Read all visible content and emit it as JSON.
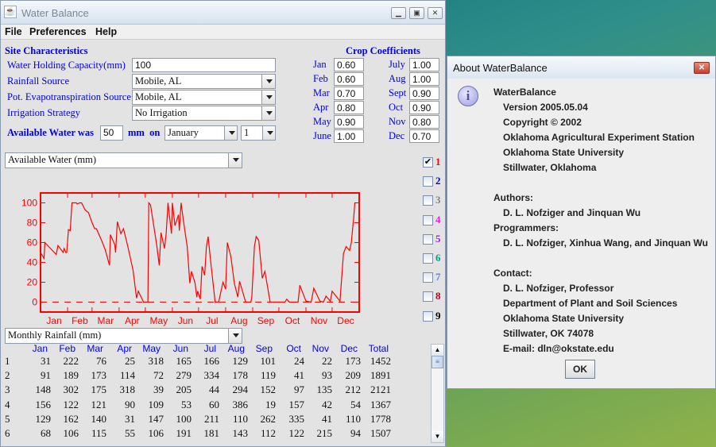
{
  "window": {
    "title": "Water Balance",
    "buttons": [
      "minimize",
      "maximize",
      "close"
    ]
  },
  "menu": [
    "File",
    "Preferences",
    "Help"
  ],
  "site": {
    "heading": "Site Characteristics",
    "whc_label": "Water Holding Capacity(mm)",
    "whc_value": "100",
    "rain_label": "Rainfall Source",
    "rain_value": "Mobile, AL",
    "pet_label": "Pot. Evapotranspiration Source",
    "pet_value": "Mobile, AL",
    "irr_label": "Irrigation Strategy",
    "irr_value": "No Irrigation",
    "aw_label": "Available Water was",
    "aw_value": "50",
    "aw_unit": "mm  on",
    "aw_month": "January",
    "aw_day": "1"
  },
  "crop": {
    "heading": "Crop Coefficients",
    "left": [
      {
        "m": "Jan",
        "v": "0.60"
      },
      {
        "m": "Feb",
        "v": "0.60"
      },
      {
        "m": "Mar",
        "v": "0.70"
      },
      {
        "m": "Apr",
        "v": "0.80"
      },
      {
        "m": "May",
        "v": "0.90"
      },
      {
        "m": "June",
        "v": "1.00"
      }
    ],
    "right": [
      {
        "m": "July",
        "v": "1.00"
      },
      {
        "m": "Aug",
        "v": "1.00"
      },
      {
        "m": "Sept",
        "v": "0.90"
      },
      {
        "m": "Oct",
        "v": "0.90"
      },
      {
        "m": "Nov",
        "v": "0.80"
      },
      {
        "m": "Dec",
        "v": "0.70"
      }
    ]
  },
  "plot_select": "Available Water (mm)",
  "series_checks": [
    {
      "n": "1",
      "checked": true,
      "color": "#ff0000"
    },
    {
      "n": "2",
      "checked": false,
      "color": "#0000ee"
    },
    {
      "n": "3",
      "checked": false,
      "color": "#808080"
    },
    {
      "n": "4",
      "checked": false,
      "color": "#e020e0"
    },
    {
      "n": "5",
      "checked": false,
      "color": "#a020f0"
    },
    {
      "n": "6",
      "checked": false,
      "color": "#00a080"
    },
    {
      "n": "7",
      "checked": false,
      "color": "#6080f0"
    },
    {
      "n": "8",
      "checked": false,
      "color": "#c00020"
    },
    {
      "n": "9",
      "checked": false,
      "color": "#000000"
    }
  ],
  "chart_data": {
    "type": "line",
    "color": "#ff0000",
    "xlabel": "",
    "ylabel": "",
    "x_ticklabels": [
      "Jan",
      "Feb",
      "Mar",
      "Apr",
      "May",
      "Jun",
      "Jul",
      "Aug",
      "Sep",
      "Oct",
      "Nov",
      "Dec"
    ],
    "y_ticks": [
      0,
      20,
      40,
      60,
      80,
      100
    ],
    "xlim": [
      0,
      365
    ],
    "ylim": [
      -10,
      110
    ],
    "reference_line": {
      "y": 0,
      "style": "dashed"
    },
    "points": [
      [
        0,
        50
      ],
      [
        4,
        44
      ],
      [
        5,
        60
      ],
      [
        18,
        48
      ],
      [
        20,
        57
      ],
      [
        26,
        50
      ],
      [
        27,
        54
      ],
      [
        29,
        50
      ],
      [
        30,
        50
      ],
      [
        32,
        73
      ],
      [
        34,
        72
      ],
      [
        36,
        100
      ],
      [
        41,
        100
      ],
      [
        42,
        99
      ],
      [
        45,
        100
      ],
      [
        47,
        100
      ],
      [
        51,
        93
      ],
      [
        55,
        90
      ],
      [
        59,
        80
      ],
      [
        62,
        74
      ],
      [
        64,
        74
      ],
      [
        70,
        62
      ],
      [
        74,
        53
      ],
      [
        79,
        37
      ],
      [
        80,
        68
      ],
      [
        85,
        58
      ],
      [
        86,
        50
      ],
      [
        88,
        81
      ],
      [
        92,
        69
      ],
      [
        95,
        74
      ],
      [
        100,
        56
      ],
      [
        106,
        32
      ],
      [
        110,
        4
      ],
      [
        112,
        11
      ],
      [
        118,
        0
      ],
      [
        123,
        0
      ],
      [
        124,
        100
      ],
      [
        126,
        98
      ],
      [
        133,
        58
      ],
      [
        136,
        37
      ],
      [
        138,
        70
      ],
      [
        142,
        54
      ],
      [
        144,
        70
      ],
      [
        146,
        100
      ],
      [
        150,
        69
      ],
      [
        151,
        100
      ],
      [
        154,
        77
      ],
      [
        158,
        88
      ],
      [
        159,
        72
      ],
      [
        161,
        100
      ],
      [
        164,
        80
      ],
      [
        168,
        56
      ],
      [
        171,
        19
      ],
      [
        173,
        31
      ],
      [
        177,
        19
      ],
      [
        179,
        5
      ],
      [
        180,
        11
      ],
      [
        183,
        3
      ],
      [
        185,
        36
      ],
      [
        188,
        27
      ],
      [
        190,
        56
      ],
      [
        192,
        66
      ],
      [
        195,
        40
      ],
      [
        200,
        0
      ],
      [
        204,
        0
      ],
      [
        209,
        20
      ],
      [
        212,
        13
      ],
      [
        214,
        60
      ],
      [
        218,
        46
      ],
      [
        222,
        19
      ],
      [
        226,
        5
      ],
      [
        228,
        21
      ],
      [
        235,
        0
      ],
      [
        241,
        0
      ],
      [
        242,
        5
      ],
      [
        245,
        56
      ],
      [
        247,
        66
      ],
      [
        250,
        62
      ],
      [
        254,
        24
      ],
      [
        257,
        31
      ],
      [
        263,
        0
      ],
      [
        280,
        0
      ],
      [
        282,
        3
      ],
      [
        285,
        0
      ],
      [
        295,
        0
      ],
      [
        297,
        17
      ],
      [
        304,
        1
      ],
      [
        310,
        0
      ],
      [
        313,
        14
      ],
      [
        320,
        1
      ],
      [
        324,
        0
      ],
      [
        327,
        6
      ],
      [
        332,
        1
      ],
      [
        334,
        11
      ],
      [
        343,
        1
      ],
      [
        347,
        49
      ],
      [
        350,
        56
      ],
      [
        354,
        52
      ],
      [
        356,
        60
      ],
      [
        359,
        88
      ],
      [
        360,
        100
      ],
      [
        361,
        100
      ]
    ]
  },
  "table_select": "Monthly Rainfall (mm)",
  "table": {
    "headers": [
      "Jan",
      "Feb",
      "Mar",
      "Apr",
      "May",
      "Jun",
      "Jul",
      "Aug",
      "Sep",
      "Oct",
      "Nov",
      "Dec",
      "Total"
    ],
    "rows": [
      [
        "1",
        "31",
        "222",
        "76",
        "25",
        "318",
        "165",
        "166",
        "129",
        "101",
        "24",
        "22",
        "173",
        "1452"
      ],
      [
        "2",
        "91",
        "189",
        "173",
        "114",
        "72",
        "279",
        "334",
        "178",
        "119",
        "41",
        "93",
        "209",
        "1891"
      ],
      [
        "3",
        "148",
        "302",
        "175",
        "318",
        "39",
        "205",
        "44",
        "294",
        "152",
        "97",
        "135",
        "212",
        "2121"
      ],
      [
        "4",
        "156",
        "122",
        "121",
        "90",
        "109",
        "53",
        "60",
        "386",
        "19",
        "157",
        "42",
        "54",
        "1367"
      ],
      [
        "5",
        "129",
        "162",
        "140",
        "31",
        "147",
        "100",
        "211",
        "110",
        "262",
        "335",
        "41",
        "110",
        "1778"
      ],
      [
        "6",
        "68",
        "106",
        "115",
        "55",
        "106",
        "191",
        "181",
        "143",
        "112",
        "122",
        "215",
        "94",
        "1507"
      ]
    ]
  },
  "about": {
    "title": "About WaterBalance",
    "lines": [
      {
        "t": "WaterBalance",
        "i": 0
      },
      {
        "t": "Version 2005.05.04",
        "i": 1
      },
      {
        "t": "Copyright © 2002",
        "i": 1
      },
      {
        "t": "Oklahoma Agricultural Experiment Station",
        "i": 1
      },
      {
        "t": "Oklahoma State University",
        "i": 1
      },
      {
        "t": "Stillwater, Oklahoma",
        "i": 1
      },
      {
        "t": "",
        "i": 0
      },
      {
        "t": "Authors:",
        "i": 0
      },
      {
        "t": "D. L. Nofziger and Jinquan Wu",
        "i": 1
      },
      {
        "t": "Programmers:",
        "i": 0
      },
      {
        "t": "D. L. Nofziger, Xinhua Wang, and Jinquan Wu",
        "i": 1
      },
      {
        "t": "",
        "i": 0
      },
      {
        "t": "Contact:",
        "i": 0
      },
      {
        "t": "D. L. Nofziger, Professor",
        "i": 1
      },
      {
        "t": "Department of Plant and Soil Sciences",
        "i": 1
      },
      {
        "t": "Oklahoma State University",
        "i": 1
      },
      {
        "t": "Stillwater, OK 74078",
        "i": 1
      },
      {
        "t": "E-mail: dln@okstate.edu",
        "i": 1
      }
    ],
    "ok": "OK"
  }
}
